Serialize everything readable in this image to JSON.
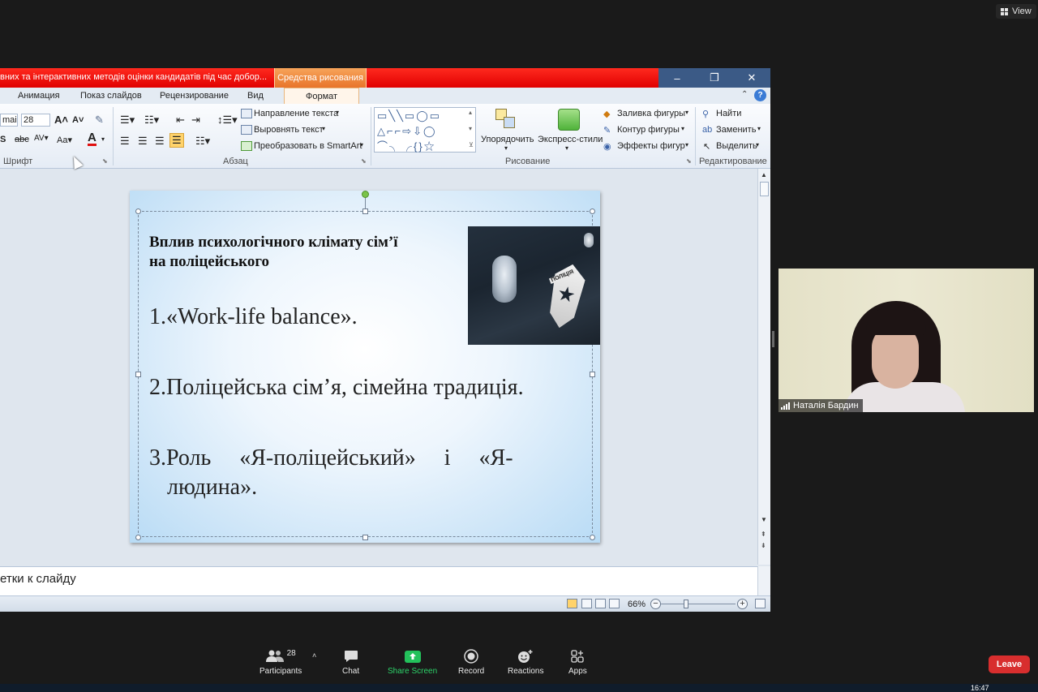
{
  "zoom_app": {
    "view_label": "View",
    "participant_name": "Наталія Бардин",
    "participants_count": "28",
    "toolbar": {
      "participants": "Participants",
      "chat": "Chat",
      "share_screen": "Share Screen",
      "record": "Record",
      "reactions": "Reactions",
      "apps": "Apps",
      "leave": "Leave"
    },
    "clock": "16:47"
  },
  "ppt": {
    "window_title": "вних та інтерактивних методів оцінки кандидатів під час добор...",
    "context_tab": "Средства рисования",
    "tabs": [
      "Анимация",
      "Показ слайдов",
      "Рецензирование",
      "Вид",
      "Формат"
    ],
    "font": {
      "font_name_partial": "mai",
      "font_size": "28",
      "group_label": "Шрифт"
    },
    "paragraph": {
      "group_label": "Абзац",
      "text_direction": "Направление текста",
      "align_text": "Выровнять текст",
      "smartart": "Преобразовать в SmartArt"
    },
    "drawing": {
      "group_label": "Рисование",
      "arrange": "Упорядочить",
      "quick_styles": "Экспресс-стили",
      "shape_fill": "Заливка фигуры",
      "shape_outline": "Контур фигуры",
      "shape_effects": "Эффекты фигур"
    },
    "editing": {
      "group_label": "Редактирование",
      "find": "Найти",
      "replace": "Заменить",
      "select": "Выделить"
    },
    "slide": {
      "title_line1": "Вплив психологічного клімату сім’ї",
      "title_line2": "на поліцейського",
      "item1": "1.«Work-life  balance».",
      "item2": "2.Поліцейська сім’я, сімейна традиція.",
      "item3_line1": "3.Роль     «Я-поліцейський»     і     «Я-",
      "item3_line2": "людина».",
      "photo_badge_text": "ПОЛІЦІЯ"
    },
    "notes_placeholder": "етки к слайду",
    "zoom_level": "66%"
  }
}
